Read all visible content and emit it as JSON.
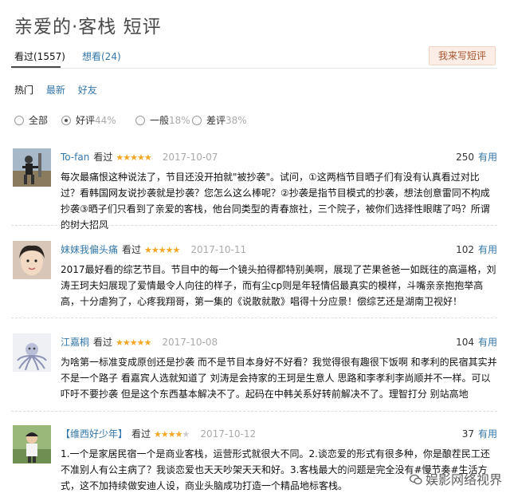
{
  "page": {
    "title": "亲爱的·客栈 短评"
  },
  "tabs": [
    {
      "label": "看过(1557)",
      "active": true
    },
    {
      "label": "想看(24)",
      "active": false
    }
  ],
  "write_button": "我来写短评",
  "sort": [
    {
      "label": "热门",
      "active": true
    },
    {
      "label": "最新",
      "active": false
    },
    {
      "label": "好友",
      "active": false
    }
  ],
  "filters": [
    {
      "label": "全部",
      "pct": "",
      "selected": false
    },
    {
      "label": "好评",
      "pct": "44%",
      "selected": true
    },
    {
      "label": "一般",
      "pct": "18%",
      "selected": false
    },
    {
      "label": "差评",
      "pct": "38%",
      "selected": false
    }
  ],
  "reviews": [
    {
      "user": "To-fan",
      "status": "看过",
      "stars": 5,
      "date": "2017-10-07",
      "votes": "250",
      "useful_label": "有用",
      "text": "每次最痛恨这种说法了，节目还没开拍就\"被抄袭\"。试问，①这两档节目晒子们有没有认真看过对比过？看韩国网友说抄袭就是抄袭？您怎么这么棒呢？②抄袭是指节目模式的抄袭，想法创意雷同不构成抄袭③晒子们只看到了亲爱的客栈，他台同类型的青春旅社，三个院子，被你们选择性眼瞎了吗？所谓的树大招风"
    },
    {
      "user": "妹妹我偏头痛",
      "status": "看过",
      "stars": 5,
      "date": "2017-10-11",
      "votes": "102",
      "useful_label": "有用",
      "text": "2017最好看的综艺节目。节目中的每一个镜头拍得都特别美啊，展现了芒果爸爸一如既往的高逼格，刘涛王珂夫妇展现了爱情最令人向往的样子，而有尘cp则是年轻情侣最真实的模样，斗嘴亲亲抱抱举高高，十分虐狗了，心疼我翔哥，第一集的《说散就散》唱得十分应景！偿综艺还是湖南卫视好！"
    },
    {
      "user": "江嘉桐",
      "status": "看过",
      "stars": 5,
      "date": "2017-10-08",
      "votes": "104",
      "useful_label": "有用",
      "text": "为啥第一标准变成原创还是抄袭 而不是节目本身好不好看？我觉得很有趣很下饭啊 和孝利的民宿其实并不是一个路子 看嘉宾人选就知道了 刘涛是会持家的王珂是生意人 思路和李孝利李尚顺并不一样。可以吓吁不要抄袭 但是这个东西基本解决不了。起码在中韩关系好转前解决不了。理智打分 别站高地"
    },
    {
      "user": "【维西好少年】",
      "status": "看过",
      "stars": 4,
      "date": "2017-10-12",
      "votes": "37",
      "useful_label": "有用",
      "text": "1.一个是家居民宿一个是商业客栈，运营形式就很大不同。2.谈恋爱的形式有很多种，你是酿茬民工还不准别人有公主病了？我谈恋爱也天天吵架天天和好。3.客栈最大的问题是完全没有#慢节奏#生活方式，这不加持续做安迪人设，商业头脑成功打造一个精品地标客栈。"
    }
  ],
  "watermark": "娱影网络视界"
}
